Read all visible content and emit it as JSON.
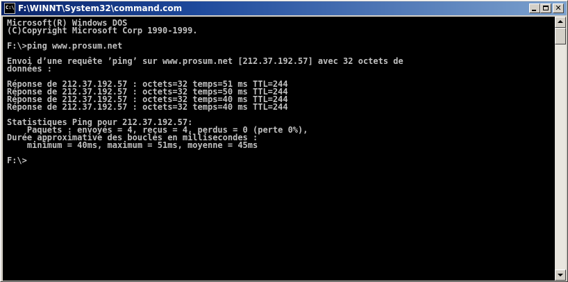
{
  "window": {
    "title": "F:\\WINNT\\System32\\command.com",
    "icon_label": "C:\\",
    "icon": "cmd-window-icon",
    "buttons": {
      "minimize": "minimize-icon",
      "maximize": "maximize-icon",
      "close": "close-icon",
      "close_glyph": "✕"
    }
  },
  "console": {
    "lines": [
      "Microsoft(R) Windows DOS",
      "(C)Copyright Microsoft Corp 1990-1999.",
      "",
      "F:\\>ping www.prosum.net",
      "",
      "Envoi d’une requête ’ping’ sur www.prosum.net [212.37.192.57] avec 32 octets de",
      "données :",
      "",
      "Réponse de 212.37.192.57 : octets=32 temps=51 ms TTL=244",
      "Réponse de 212.37.192.57 : octets=32 temps=50 ms TTL=244",
      "Réponse de 212.37.192.57 : octets=32 temps=40 ms TTL=244",
      "Réponse de 212.37.192.57 : octets=32 temps=40 ms TTL=244",
      "",
      "Statistiques Ping pour 212.37.192.57:",
      "    Paquets : envoyés = 4, reçus = 4, perdus = 0 (perte 0%),",
      "Durée approximative des boucles en millisecondes :",
      "    minimum = 40ms, maximum = 51ms, moyenne = 45ms",
      "",
      "F:\\>"
    ]
  },
  "colors": {
    "titlebar_start": "#0a246a",
    "titlebar_end": "#7da2ce",
    "console_bg": "#000000",
    "console_fg": "#c0c0c0",
    "chrome": "#d4d0c8"
  },
  "scrollbar": {
    "up_icon": "scroll-up-arrow-icon",
    "down_icon": "scroll-down-arrow-icon"
  }
}
